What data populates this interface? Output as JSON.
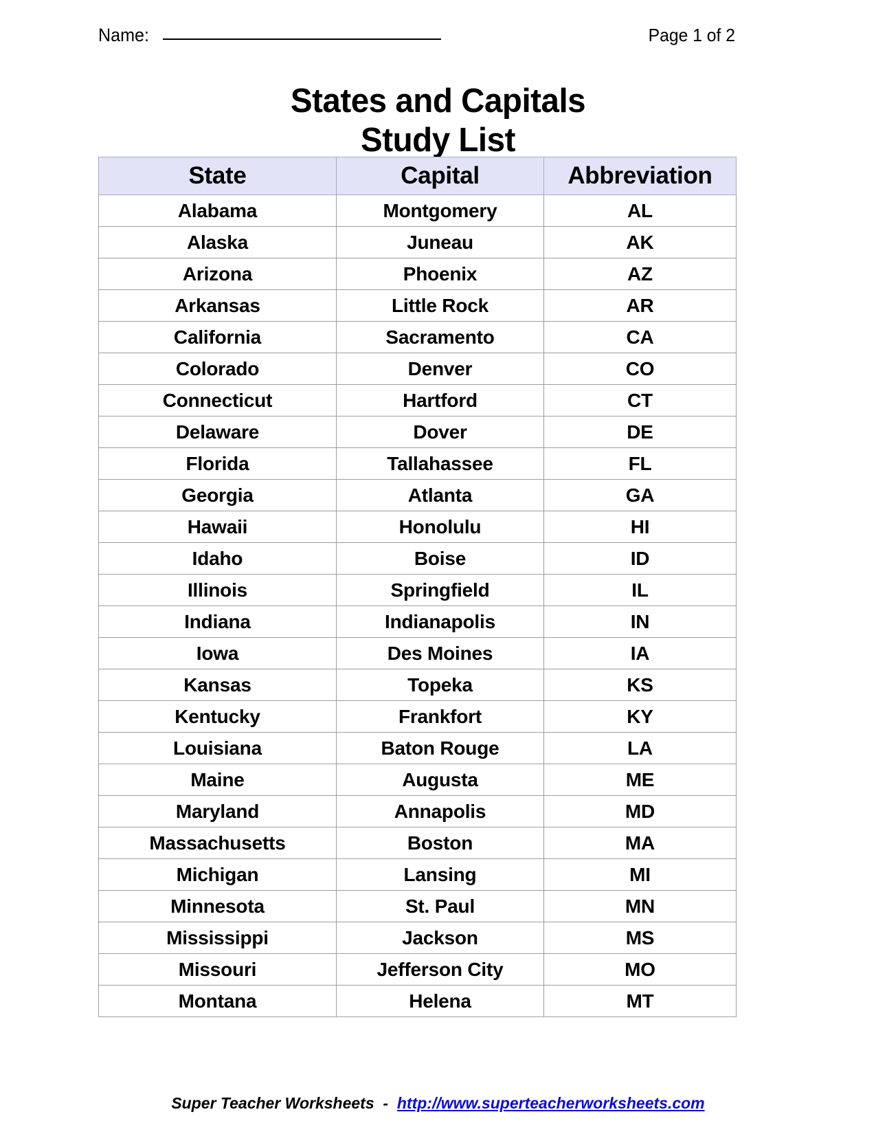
{
  "header": {
    "name_label": "Name:",
    "name_blank": "______________________________",
    "page_label": "Page 1 of 2"
  },
  "title": {
    "line1": "States and Capitals",
    "line2": "Study List"
  },
  "table": {
    "columns": [
      "State",
      "Capital",
      "Abbreviation"
    ],
    "header_bg": "#e3e3f8",
    "border_color": "#9e9e9e",
    "rows": [
      [
        "Alabama",
        "Montgomery",
        "AL"
      ],
      [
        "Alaska",
        "Juneau",
        "AK"
      ],
      [
        "Arizona",
        "Phoenix",
        "AZ"
      ],
      [
        "Arkansas",
        "Little Rock",
        "AR"
      ],
      [
        "California",
        "Sacramento",
        "CA"
      ],
      [
        "Colorado",
        "Denver",
        "CO"
      ],
      [
        "Connecticut",
        "Hartford",
        "CT"
      ],
      [
        "Delaware",
        "Dover",
        "DE"
      ],
      [
        "Florida",
        "Tallahassee",
        "FL"
      ],
      [
        "Georgia",
        "Atlanta",
        "GA"
      ],
      [
        "Hawaii",
        "Honolulu",
        "HI"
      ],
      [
        "Idaho",
        "Boise",
        "ID"
      ],
      [
        "Illinois",
        "Springfield",
        "IL"
      ],
      [
        "Indiana",
        "Indianapolis",
        "IN"
      ],
      [
        "Iowa",
        "Des Moines",
        "IA"
      ],
      [
        "Kansas",
        "Topeka",
        "KS"
      ],
      [
        "Kentucky",
        "Frankfort",
        "KY"
      ],
      [
        "Louisiana",
        "Baton Rouge",
        "LA"
      ],
      [
        "Maine",
        "Augusta",
        "ME"
      ],
      [
        "Maryland",
        "Annapolis",
        "MD"
      ],
      [
        "Massachusetts",
        "Boston",
        "MA"
      ],
      [
        "Michigan",
        "Lansing",
        "MI"
      ],
      [
        "Minnesota",
        "St. Paul",
        "MN"
      ],
      [
        "Mississippi",
        "Jackson",
        "MS"
      ],
      [
        "Missouri",
        "Jefferson City",
        "MO"
      ],
      [
        "Montana",
        "Helena",
        "MT"
      ]
    ]
  },
  "footer": {
    "brand": "Super Teacher Worksheets",
    "separator": "-",
    "url": "http://www.superteacherworksheets.com",
    "url_color": "#0b0bdd"
  }
}
